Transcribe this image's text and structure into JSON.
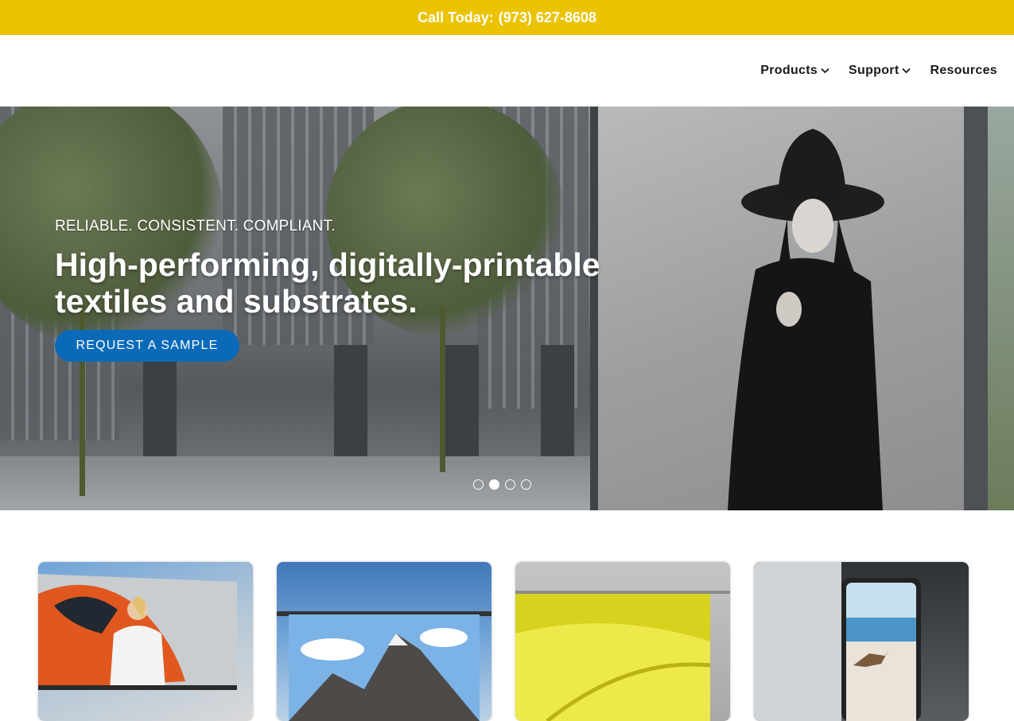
{
  "topbar": {
    "label": "Call Today:",
    "phone": "(973) 627-8608",
    "background_color": "#ebc300"
  },
  "nav": {
    "items": [
      {
        "label": "Products",
        "has_dropdown": true,
        "icon": "chevron-down-icon"
      },
      {
        "label": "Support",
        "has_dropdown": true,
        "icon": "chevron-down-icon"
      },
      {
        "label": "Resources",
        "has_dropdown": false
      }
    ]
  },
  "hero": {
    "eyebrow": "RELIABLE. CONSISTENT. COMPLIANT.",
    "headline_line1": "High-performing, digitally-printable",
    "headline_line2": "textiles and substrates.",
    "cta_label": "REQUEST A SAMPLE",
    "cta_color": "#0b6ab8",
    "carousel": {
      "total_slides": 4,
      "active_index": 1
    }
  },
  "cards": [
    {
      "image": "billboard-woman-car"
    },
    {
      "image": "banner-mountains"
    },
    {
      "image": "banner-yellow-flower"
    },
    {
      "image": "backlit-frame-running-dog"
    }
  ]
}
